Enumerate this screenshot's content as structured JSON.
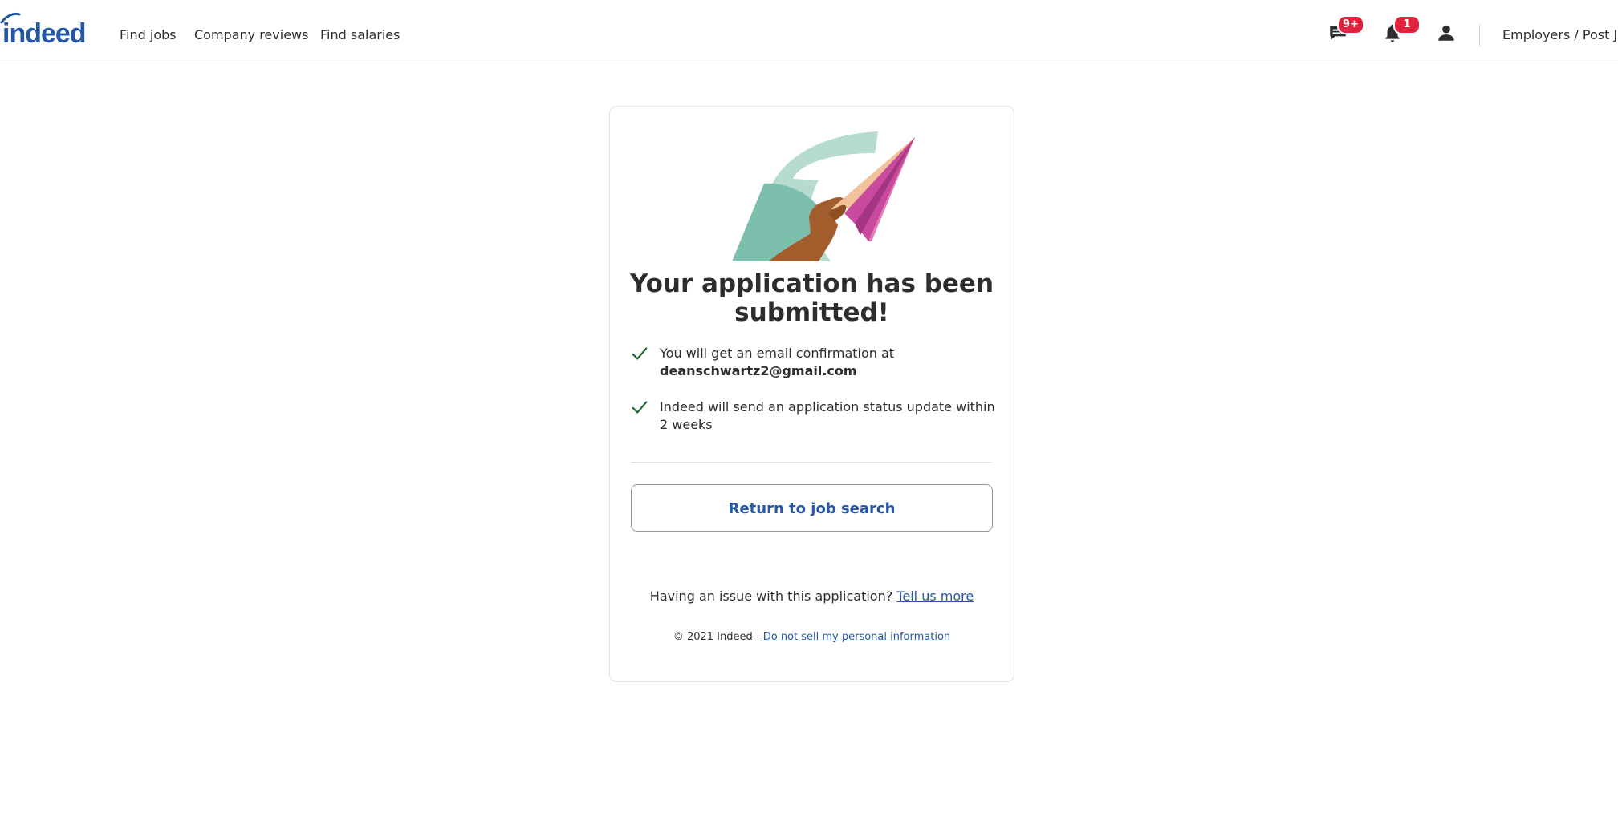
{
  "header": {
    "logo_text": "indeed",
    "nav": [
      {
        "label": "Find jobs"
      },
      {
        "label": "Company reviews"
      },
      {
        "label": "Find salaries"
      }
    ],
    "messages_badge": "9+",
    "notifications_badge": "1",
    "employers_link": "Employers / Post Job"
  },
  "confirmation": {
    "title": "Your application has been submitted!",
    "items": [
      {
        "text": "You will get an email confirmation at",
        "email": "deanschwartz2@gmail.com"
      },
      {
        "text": "Indeed will send an application status update within 2 weeks"
      }
    ],
    "return_button": "Return to job search",
    "issue_prompt": "Having an issue with this application?",
    "issue_link": "Tell us more",
    "copyright": "© 2021 Indeed -",
    "privacy_link": "Do not sell my personal information"
  },
  "colors": {
    "brand_blue": "#2557a7",
    "badge_red": "#e0223c",
    "check_green": "#1f662c",
    "teal": "#7bbfac",
    "pink": "#c94a9c"
  },
  "icons": {
    "messages": "chat-icon",
    "notifications": "bell-icon",
    "profile": "person-icon",
    "check": "check-icon"
  }
}
